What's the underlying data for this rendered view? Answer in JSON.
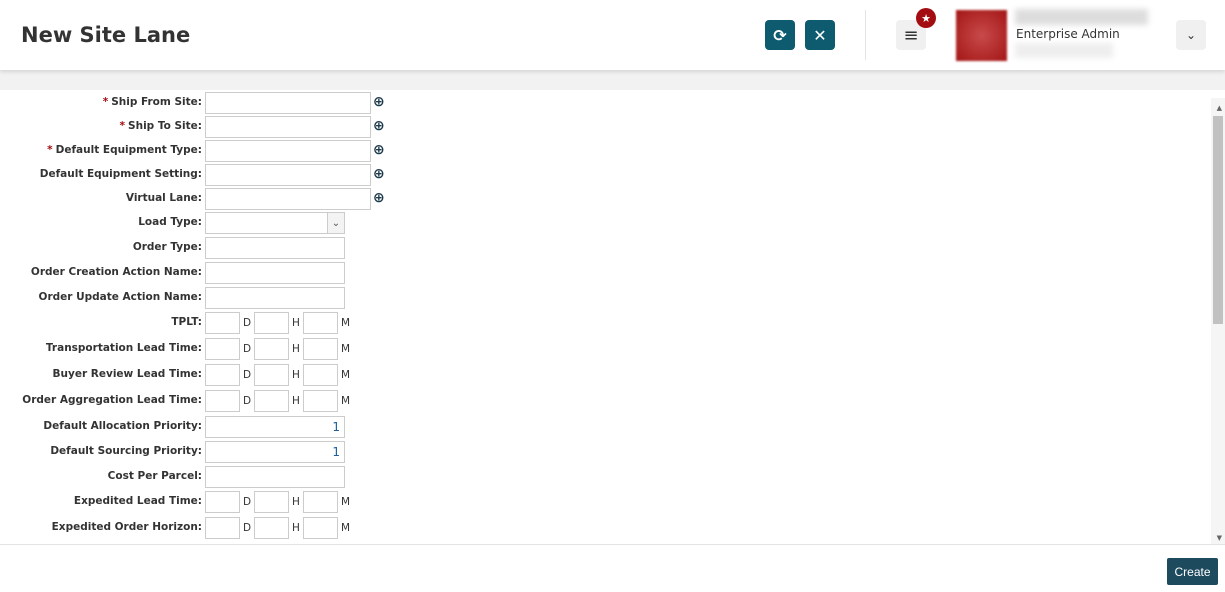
{
  "header": {
    "title": "New Site Lane",
    "role": "Enterprise Admin"
  },
  "form": {
    "fields": [
      {
        "label": "Ship From Site:",
        "required": true,
        "type": "lookup"
      },
      {
        "label": "Ship To Site:",
        "required": true,
        "type": "lookup"
      },
      {
        "label": "Default Equipment Type:",
        "required": true,
        "type": "lookup"
      },
      {
        "label": "Default Equipment Setting:",
        "required": false,
        "type": "lookup"
      },
      {
        "label": "Virtual Lane:",
        "required": false,
        "type": "lookup"
      },
      {
        "label": "Load Type:",
        "required": false,
        "type": "select"
      },
      {
        "label": "Order Type:",
        "required": false,
        "type": "text"
      },
      {
        "label": "Order Creation Action Name:",
        "required": false,
        "type": "text"
      },
      {
        "label": "Order Update Action Name:",
        "required": false,
        "type": "text"
      },
      {
        "label": "TPLT:",
        "required": false,
        "type": "duration"
      },
      {
        "label": "Transportation Lead Time:",
        "required": false,
        "type": "duration"
      },
      {
        "label": "Buyer Review Lead Time:",
        "required": false,
        "type": "duration"
      },
      {
        "label": "Order Aggregation Lead Time:",
        "required": false,
        "type": "duration"
      },
      {
        "label": "Default Allocation Priority:",
        "required": false,
        "type": "number",
        "value": "1"
      },
      {
        "label": "Default Sourcing Priority:",
        "required": false,
        "type": "number",
        "value": "1"
      },
      {
        "label": "Cost Per Parcel:",
        "required": false,
        "type": "text"
      },
      {
        "label": "Expedited Lead Time:",
        "required": false,
        "type": "duration"
      },
      {
        "label": "Expedited Order Horizon:",
        "required": false,
        "type": "duration"
      }
    ],
    "units": {
      "d": "D",
      "h": "H",
      "m": "M"
    },
    "required_mark": "*"
  },
  "footer": {
    "create_label": "Create"
  }
}
